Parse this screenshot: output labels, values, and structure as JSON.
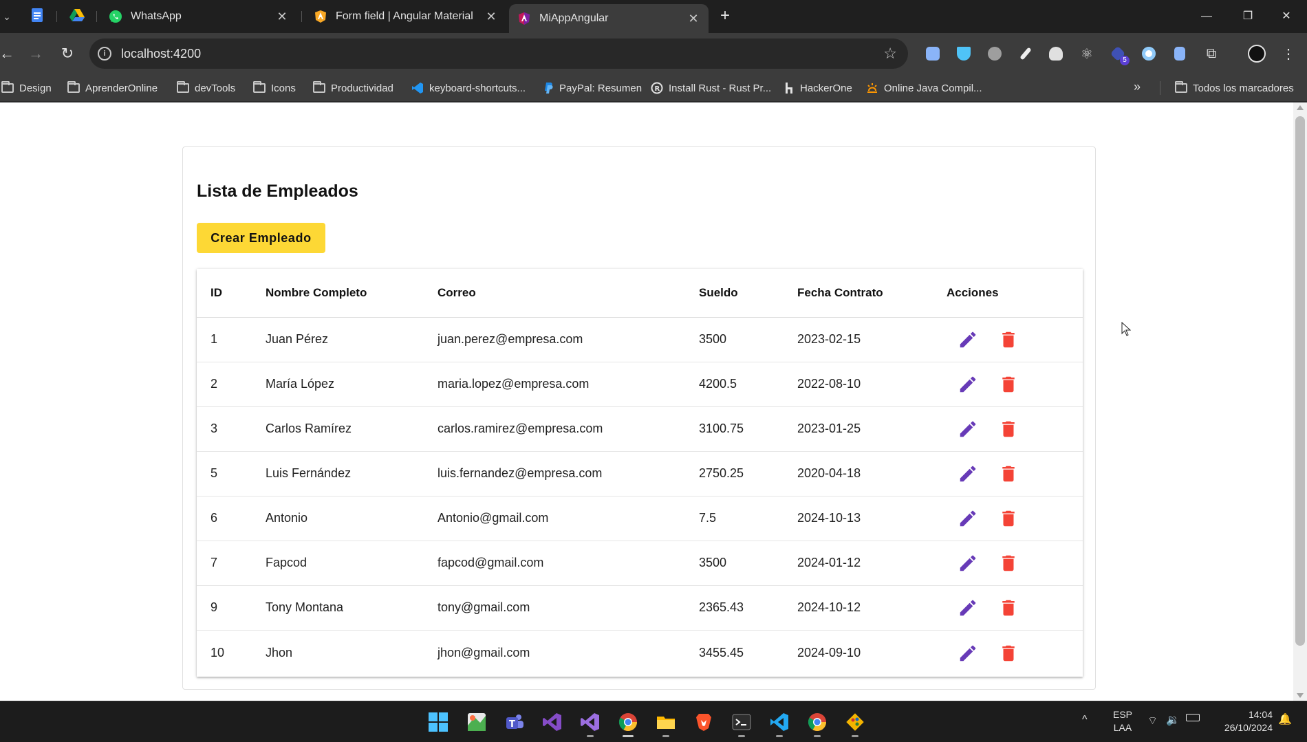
{
  "browser": {
    "tabs": [
      {
        "title": "WhatsApp",
        "icon": "whatsapp-icon"
      },
      {
        "title": "Form field | Angular Material",
        "icon": "angular-material-icon"
      },
      {
        "title": "MiAppAngular",
        "icon": "angular-icon",
        "active": true
      }
    ],
    "pinned_tabs": [
      "google-docs-icon",
      "google-drive-icon"
    ],
    "url": "localhost:4200",
    "bookmarks": [
      {
        "label": "Design",
        "icon": "folder-icon"
      },
      {
        "label": "AprenderOnline",
        "icon": "folder-icon"
      },
      {
        "label": "devTools",
        "icon": "folder-icon"
      },
      {
        "label": "Icons",
        "icon": "folder-icon"
      },
      {
        "label": "Productividad",
        "icon": "folder-icon"
      },
      {
        "label": "keyboard-shortcuts...",
        "icon": "vscode-icon"
      },
      {
        "label": "PayPal: Resumen",
        "icon": "paypal-icon"
      },
      {
        "label": "Install Rust - Rust Pr...",
        "icon": "rust-icon"
      },
      {
        "label": "HackerOne",
        "icon": "hackerone-icon"
      },
      {
        "label": "Online Java Compil...",
        "icon": "java-icon"
      }
    ],
    "all_bookmarks_label": "Todos los marcadores",
    "extension_badge": "5"
  },
  "page": {
    "title": "Lista de Empleados",
    "create_button": "Crear Empleado",
    "columns": [
      "ID",
      "Nombre Completo",
      "Correo",
      "Sueldo",
      "Fecha Contrato",
      "Acciones"
    ],
    "rows": [
      {
        "id": "1",
        "name": "Juan Pérez",
        "email": "juan.perez@empresa.com",
        "salary": "3500",
        "date": "2023-02-15"
      },
      {
        "id": "2",
        "name": "María López",
        "email": "maria.lopez@empresa.com",
        "salary": "4200.5",
        "date": "2022-08-10"
      },
      {
        "id": "3",
        "name": "Carlos Ramírez",
        "email": "carlos.ramirez@empresa.com",
        "salary": "3100.75",
        "date": "2023-01-25"
      },
      {
        "id": "5",
        "name": "Luis Fernández",
        "email": "luis.fernandez@empresa.com",
        "salary": "2750.25",
        "date": "2020-04-18"
      },
      {
        "id": "6",
        "name": "Antonio",
        "email": "Antonio@gmail.com",
        "salary": "7.5",
        "date": "2024-10-13"
      },
      {
        "id": "7",
        "name": "Fapcod",
        "email": "fapcod@gmail.com",
        "salary": "3500",
        "date": "2024-01-12"
      },
      {
        "id": "9",
        "name": "Tony Montana",
        "email": "tony@gmail.com",
        "salary": "2365.43",
        "date": "2024-10-12"
      },
      {
        "id": "10",
        "name": "Jhon",
        "email": "jhon@gmail.com",
        "salary": "3455.45",
        "date": "2024-09-10"
      }
    ],
    "colors": {
      "edit": "#673ab7",
      "delete": "#f44336",
      "create": "#fdd835"
    }
  },
  "taskbar": {
    "apps": [
      "windows-start-icon",
      "paint-icon",
      "teams-icon",
      "visual-studio-icon",
      "visual-studio-preview-icon",
      "chrome-icon",
      "file-explorer-icon",
      "brave-icon",
      "terminal-icon",
      "vscode-icon",
      "chrome-alt-icon",
      "git-icon"
    ],
    "language": "ESP",
    "layout": "LAA",
    "time": "14:04",
    "date": "26/10/2024"
  }
}
